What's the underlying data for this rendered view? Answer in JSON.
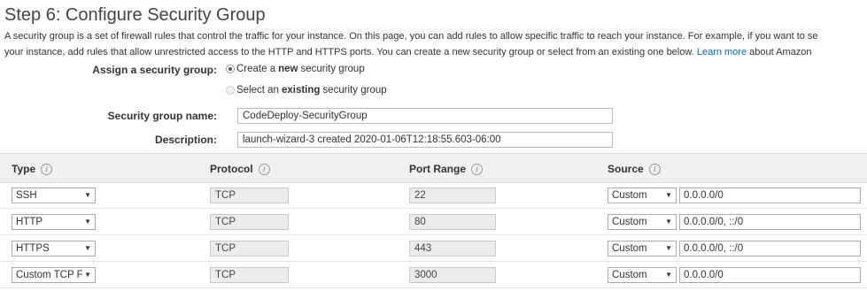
{
  "page": {
    "title": "Step 6: Configure Security Group",
    "desc_line1": "A security group is a set of firewall rules that control the traffic for your instance. On this page, you can add rules to allow specific traffic to reach your instance. For example, if you want to se",
    "desc_line2": "your instance, add rules that allow unrestricted access to the HTTP and HTTPS ports. You can create a new security group or select from an existing one below.",
    "learn_more": "Learn more",
    "desc_tail": "about Amazon"
  },
  "assign": {
    "label": "Assign a security group:",
    "opt_create_pre": "Create a",
    "opt_create_bold": "new",
    "opt_create_post": "security group",
    "opt_select_pre": "Select an",
    "opt_select_bold": "existing",
    "opt_select_post": "security group"
  },
  "form": {
    "name_label": "Security group name:",
    "name_value": "CodeDeploy-SecurityGroup",
    "desc_label": "Description:",
    "desc_value": "launch-wizard-3 created 2020-01-06T12:18:55.603-06:00"
  },
  "table": {
    "headers": [
      "Type",
      "Protocol",
      "Port Range",
      "Source"
    ],
    "info_glyph": "i",
    "rows": [
      {
        "type": "SSH",
        "protocol": "TCP",
        "port": "22",
        "source_type": "Custom",
        "source": "0.0.0.0/0"
      },
      {
        "type": "HTTP",
        "protocol": "TCP",
        "port": "80",
        "source_type": "Custom",
        "source": "0.0.0.0/0, ::/0"
      },
      {
        "type": "HTTPS",
        "protocol": "TCP",
        "port": "443",
        "source_type": "Custom",
        "source": "0.0.0.0/0, ::/0"
      },
      {
        "type": "Custom TCP F",
        "protocol": "TCP",
        "port": "3000",
        "source_type": "Custom",
        "source": "0.0.0.0/0"
      }
    ]
  },
  "icons": {
    "dropdown": "chevron-down-icon",
    "info": "info-icon"
  },
  "colors": {
    "link": "#1166bb",
    "header_bg": "#f0f0f0",
    "readonly_bg": "#ececec"
  }
}
